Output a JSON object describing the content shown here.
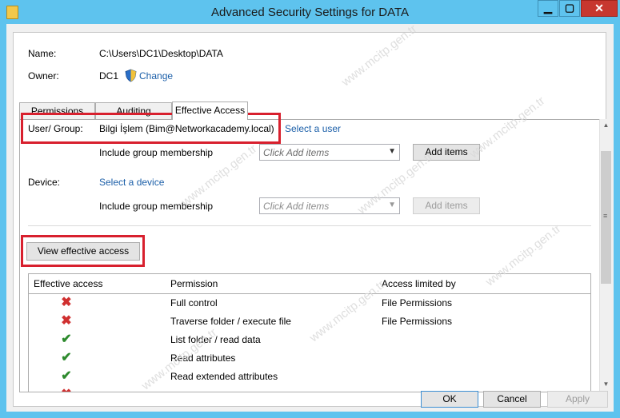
{
  "window": {
    "title": "Advanced Security Settings for DATA"
  },
  "general": {
    "name_label": "Name:",
    "name_value": "C:\\Users\\DC1\\Desktop\\DATA",
    "owner_label": "Owner:",
    "owner_value": "DC1",
    "change_link": "Change"
  },
  "tabs": [
    {
      "label": "Permissions",
      "active": false
    },
    {
      "label": "Auditing",
      "active": false
    },
    {
      "label": "Effective Access",
      "active": true
    }
  ],
  "user": {
    "label": "User/ Group:",
    "value": "Bilgi İşlem (Bim@Networkacademy.local)",
    "select_link": "Select a user",
    "group_label": "Include group membership",
    "combo_placeholder": "Click Add items",
    "add_button": "Add items"
  },
  "device": {
    "label": "Device:",
    "select_link": "Select a device",
    "group_label": "Include group membership",
    "combo_placeholder": "Click Add items",
    "add_button": "Add items"
  },
  "view_button": "View effective access",
  "table": {
    "headers": [
      "Effective access",
      "Permission",
      "Access limited by"
    ],
    "rows": [
      {
        "icon": "deny-x-icon",
        "permission": "Full control",
        "limited_by": "File Permissions"
      },
      {
        "icon": "deny-x-icon",
        "permission": "Traverse folder / execute file",
        "limited_by": "File Permissions"
      },
      {
        "icon": "allow-check-icon",
        "permission": "List folder / read data",
        "limited_by": ""
      },
      {
        "icon": "allow-check-icon",
        "permission": "Read attributes",
        "limited_by": ""
      },
      {
        "icon": "allow-check-icon",
        "permission": "Read extended attributes",
        "limited_by": ""
      },
      {
        "icon": "deny-x-icon",
        "permission": "",
        "limited_by": ""
      }
    ]
  },
  "footer": {
    "ok": "OK",
    "cancel": "Cancel",
    "apply": "Apply"
  },
  "watermark": "www.mcitp.gen.tr",
  "colors": {
    "highlight_border": "#d8202e",
    "link": "#1a5ea8",
    "title_bar": "#5ec3ee"
  }
}
